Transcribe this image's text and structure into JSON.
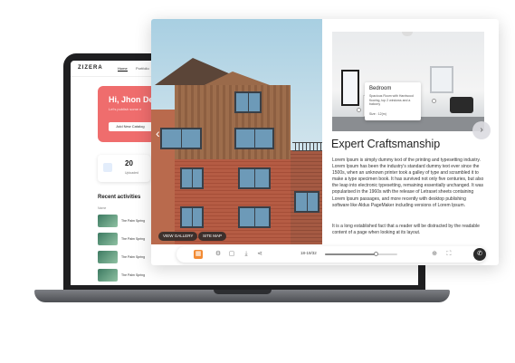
{
  "laptop_app": {
    "logo": "ZIZERA",
    "nav": [
      "Home",
      "Portfolio"
    ],
    "welcome_title": "Hi, Jhon De",
    "welcome_sub": "Let's publish some e",
    "create_button": "Add New Catalog",
    "stat_value": "20",
    "stat_label": "Uploaded",
    "recent_title": "Recent activities",
    "recent_header": "Name",
    "recent_items": [
      "The Palm Spring",
      "The Palm Spring",
      "The Palm Spring",
      "The Palm Spring"
    ]
  },
  "viewer": {
    "photo_buttons": [
      "VIEW GALLERY",
      "SITE MAP"
    ],
    "bedroom_card": {
      "title": "Bedroom",
      "desc": "Spacious Room with Hardwood flooring, top 2 windows and a balcony",
      "size": "Size : 12(m)"
    },
    "heading": "Expert Craftsmanship",
    "paragraph1": "Lorem Ipsum is simply dummy text of the printing and typesetting industry. Lorem Ipsum has been the industry's standard dummy text ever since the 1500s, when an unknown printer took a galley of type and scrambled it to make a type specimen book. It has survived not only five centuries, but also the leap into electronic typesetting, remaining essentially unchanged. It was popularised in the 1960s with the release of Letraset sheets containing Lorem Ipsum passages, and more recently with desktop publishing software like Aldus PageMaker including versions of Lorem Ipsum.",
    "paragraph2": "It is a long established fact that a reader will be distracted by the readable content of a page when looking at its layout.",
    "toolbar": {
      "page_label": "18-19/32",
      "progress": 0.7
    }
  },
  "colors": {
    "accent": "#f28b33",
    "welcome_card": "#ef6d6d"
  }
}
